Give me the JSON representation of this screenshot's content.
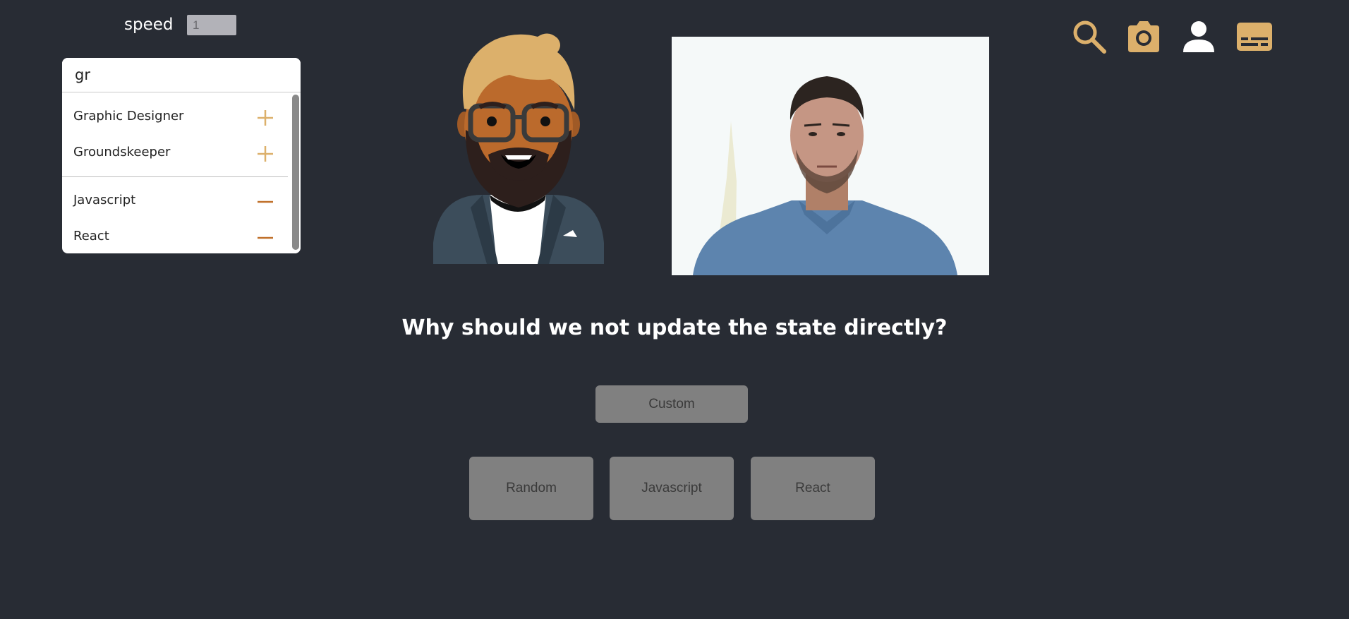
{
  "speed": {
    "label": "speed",
    "value": "1"
  },
  "tag_search": {
    "value": "gr",
    "suggestions": [
      {
        "label": "Graphic Designer",
        "action": "+"
      },
      {
        "label": "Groundskeeper",
        "action": "+"
      }
    ],
    "selected": [
      {
        "label": "Javascript",
        "action": "−"
      },
      {
        "label": "React",
        "action": "−"
      }
    ]
  },
  "question": "Why should we not update the state directly?",
  "buttons": {
    "custom": "Custom",
    "topics": [
      "Random",
      "Javascript",
      "React"
    ]
  },
  "toolbar": {
    "icons": [
      "search-icon",
      "camera-icon",
      "user-icon",
      "subtitles-icon"
    ]
  },
  "colors": {
    "background": "#282c34",
    "accent": "#dcb06b",
    "remove": "#c0702a",
    "button": "#808080"
  }
}
